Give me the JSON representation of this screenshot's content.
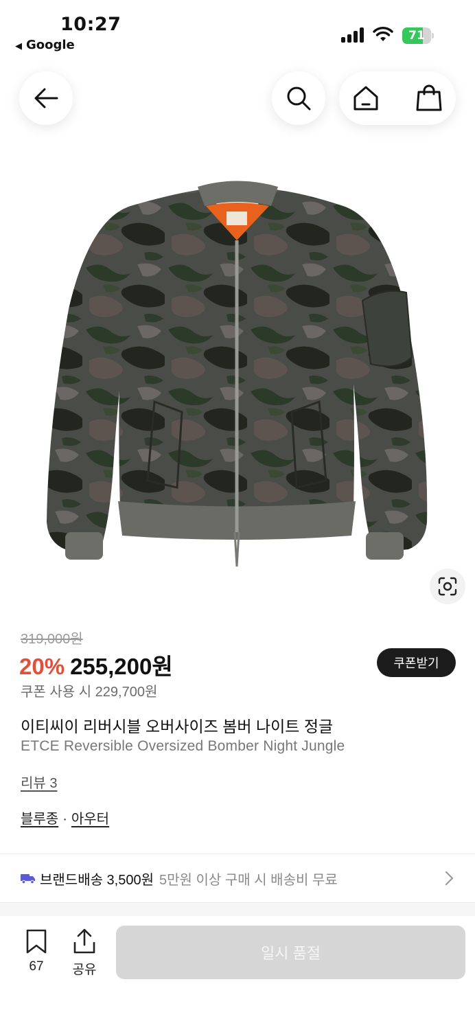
{
  "status_bar": {
    "time": "10:27",
    "back_app": "Google",
    "battery_level": "71",
    "battery_fraction": 0.71
  },
  "header": {
    "icons": [
      "back-arrow-icon",
      "search-icon",
      "home-icon",
      "shopping-bag-icon"
    ]
  },
  "product": {
    "image_alt": "camouflage bomber jacket",
    "original_price": "319,000원",
    "discount": "20%",
    "sale_price": "255,200원",
    "coupon_button": "쿠폰받기",
    "coupon_price": "쿠폰 사용 시 229,700원",
    "title_ko": "이티씨이 리버시블 오버사이즈 봄버 나이트 정글",
    "title_en": "ETCE Reversible Oversized Bomber Night Jungle",
    "review": "리뷰 3",
    "categories": [
      "블루종",
      "아우터"
    ],
    "category_separator": "·"
  },
  "shipping": {
    "label": "브랜드배송 3,500원",
    "note": "5만원 이상 구매 시 배송비 무료",
    "icon_color": "#5b5bd6"
  },
  "bottom_bar": {
    "wish_count": "67",
    "share_label": "공유",
    "cta_label": "일시 품절"
  },
  "colors": {
    "discount": "#e0503a",
    "coupon_button_bg": "#1c1c1c",
    "soldout_bg": "#d6d6d6"
  }
}
